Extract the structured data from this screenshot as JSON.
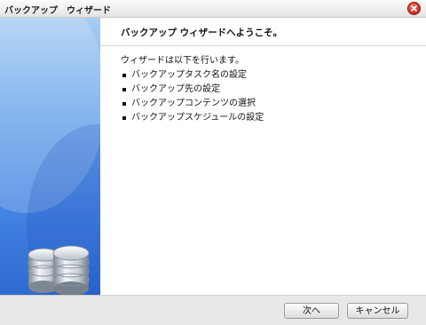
{
  "window": {
    "title": "バックアップ　ウィザード"
  },
  "header": {
    "title": "バックアップ ウィザードへようこそ。"
  },
  "body": {
    "intro": "ウィザードは以下を行います。",
    "steps": [
      "バックアップタスク名の設定",
      "バックアップ先の設定",
      "バックアップコンテンツの選択",
      "バックアップスケジュールの設定"
    ]
  },
  "footer": {
    "next_label": "次へ",
    "cancel_label": "キャンセル"
  },
  "icons": {
    "close": "close-icon",
    "sidebar": "database-icon"
  },
  "colors": {
    "sidebar_blue": "#3f7fe0",
    "close_red": "#d2392a"
  }
}
